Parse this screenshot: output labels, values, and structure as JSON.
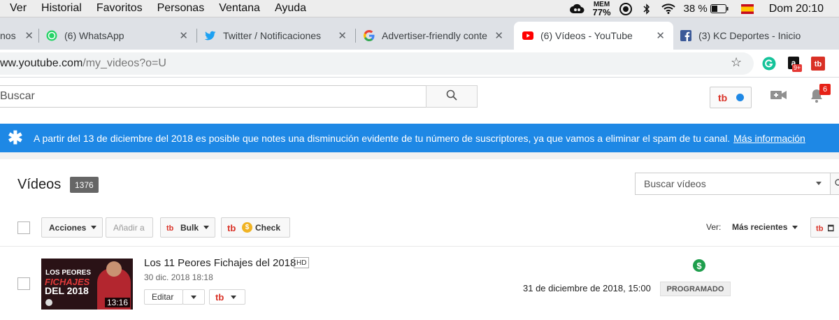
{
  "menubar": {
    "items": [
      "Ver",
      "Historial",
      "Favoritos",
      "Personas",
      "Ventana",
      "Ayuda"
    ],
    "mem_label": "MEM",
    "mem_value": "77%",
    "battery_pct": "38 %",
    "clock": "Dom 20:10"
  },
  "tabs": [
    {
      "label": "nos",
      "favicon": "generic-icon"
    },
    {
      "label": "(6) WhatsApp",
      "favicon": "whatsapp-icon"
    },
    {
      "label": "Twitter / Notificaciones",
      "favicon": "twitter-icon"
    },
    {
      "label": "Advertiser-friendly conte",
      "favicon": "google-icon"
    },
    {
      "label": "(6) Vídeos - YouTube",
      "favicon": "youtube-icon",
      "active": true
    },
    {
      "label": "(3) KC Deportes - Inicio",
      "favicon": "facebook-icon"
    }
  ],
  "address": {
    "host": "ww.youtube.com",
    "path": "/my_videos?o=U",
    "ext_badge": "9+"
  },
  "yt_header": {
    "search_placeholder": "Buscar",
    "notif_count": "6"
  },
  "banner": {
    "text": "A partir del 13 de diciembre del 2018 es posible que notes una disminución evidente de tu número de suscriptores, ya que vamos a eliminar el spam de tu canal.",
    "link": "Más información"
  },
  "videos": {
    "title": "Vídeos",
    "count": "1376",
    "search_placeholder": "Buscar vídeos",
    "actions_label": "Acciones",
    "add_to_label": "Añadir a",
    "bulk_label": "Bulk",
    "check_label": "Check",
    "ver_label": "Ver:",
    "sort_label": "Más recientes"
  },
  "rows": [
    {
      "title": "Los 11 Peores Fichajes del 2018",
      "hd": "HD",
      "date": "30 dic. 2018 18:18",
      "edit_label": "Editar",
      "scheduled": "31 de diciembre de 2018, 15:00",
      "status": "PROGRAMADO",
      "monetization": "$",
      "thumb_line1": "LOS PEORES",
      "thumb_line2": "FICHAJES",
      "thumb_line3": "DEL 2018",
      "duration": "13:16"
    }
  ],
  "colors": {
    "banner": "#1e88e5",
    "youtube_red": "#ff0000",
    "tubebuddy_red": "#d93025",
    "money_green": "#1e9e4c"
  }
}
